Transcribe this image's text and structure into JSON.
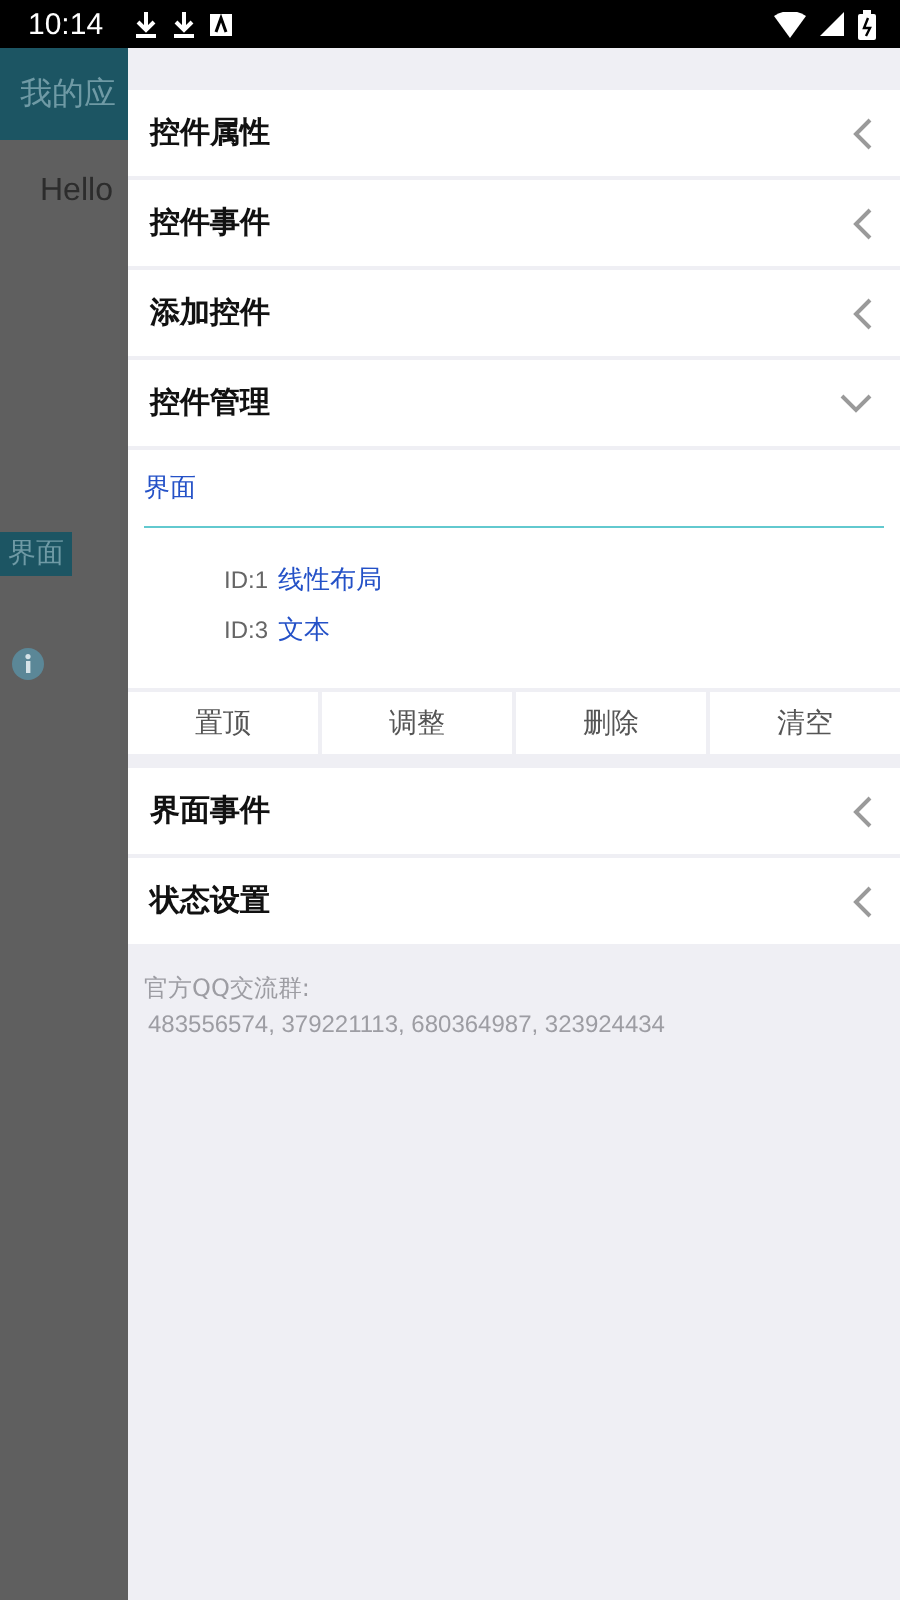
{
  "status_bar": {
    "time": "10:14"
  },
  "background_app": {
    "title": "我的应",
    "text": "Hello",
    "badge": "界面"
  },
  "sections": [
    {
      "label": "控件属性",
      "expanded": false
    },
    {
      "label": "控件事件",
      "expanded": false
    },
    {
      "label": "添加控件",
      "expanded": false
    },
    {
      "label": "控件管理",
      "expanded": true,
      "content": {
        "tab": "界面",
        "items": [
          {
            "id": "ID:1",
            "name": "线性布局"
          },
          {
            "id": "ID:3",
            "name": "文本"
          }
        ],
        "buttons": [
          "置顶",
          "调整",
          "删除",
          "清空"
        ]
      }
    },
    {
      "label": "界面事件",
      "expanded": false
    },
    {
      "label": "状态设置",
      "expanded": false
    }
  ],
  "footer": {
    "title": "官方QQ交流群:",
    "numbers": "483556574, 379221113, 680364987, 323924434"
  }
}
